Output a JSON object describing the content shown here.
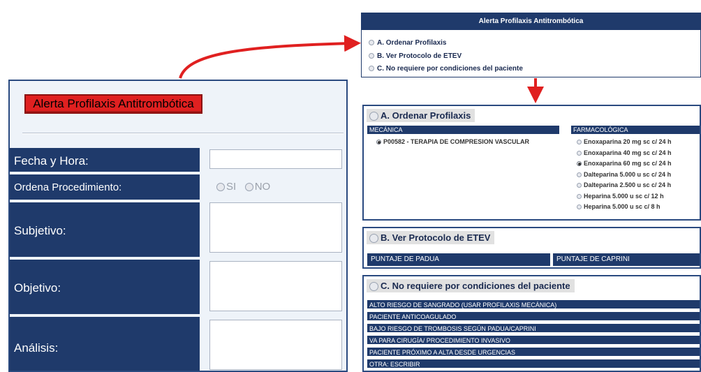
{
  "form": {
    "alert_button_label": "Alerta Profilaxis Antitrombótica",
    "fields": {
      "fecha_label": "Fecha y Hora:",
      "fecha_value": "",
      "ordena_label": "Ordena Procedimiento:",
      "si_label": "SI",
      "no_label": "NO",
      "subjetivo_label": "Subjetivo:",
      "objetivo_label": "Objetivo:",
      "analisis_label": "Análisis:"
    }
  },
  "dialog": {
    "title": "Alerta Profilaxis Antitrombótica",
    "options": [
      "A. Ordenar Profilaxis",
      "B. Ver Protocolo de ETEV",
      "C. No requiere por condiciones del paciente"
    ]
  },
  "section_a": {
    "title": "A. Ordenar Profilaxis",
    "mecanica_header": "MECÁNICA",
    "mecanica_item": "P00582 - TERAPIA DE COMPRESION VASCULAR",
    "farmacologica_header": "FARMACOLÓGICA",
    "farmacologica_items": [
      "Enoxaparina 20 mg sc c/ 24 h",
      "Enoxaparina 40 mg sc c/ 24 h",
      "Enoxaparina 60 mg sc c/ 24 h",
      "Dalteparina 5.000 u sc c/ 24 h",
      "Dalteparina 2.500 u sc c/ 24 h",
      "Heparina 5.000 u sc c/ 12 h",
      "Heparina 5.000 u sc c/ 8 h"
    ],
    "farmacologica_selected": 2
  },
  "section_b": {
    "title": "B. Ver Protocolo de ETEV",
    "padua_label": "PUNTAJE DE PADUA",
    "caprini_label": "PUNTAJE DE CAPRINI"
  },
  "section_c": {
    "title": "C. No requiere por condiciones del paciente",
    "reasons": [
      "ALTO RIESGO DE SANGRADO (USAR PROFILAXIS MECÁNICA)",
      "PACIENTE ANTICOAGULADO",
      "BAJO RIESGO DE TROMBOSIS SEGÚN PADUA/CAPRINI",
      "VA PARA CIRUGÍA/ PROCEDIMIENTO INVASIVO",
      "PACIENTE PRÓXIMO A ALTA DESDE URGENCIAS",
      "OTRA: ESCRIBIR"
    ]
  },
  "colors": {
    "navy": "#1f3a6b",
    "alert_red": "#e02020",
    "arrow_red": "#e02020"
  }
}
